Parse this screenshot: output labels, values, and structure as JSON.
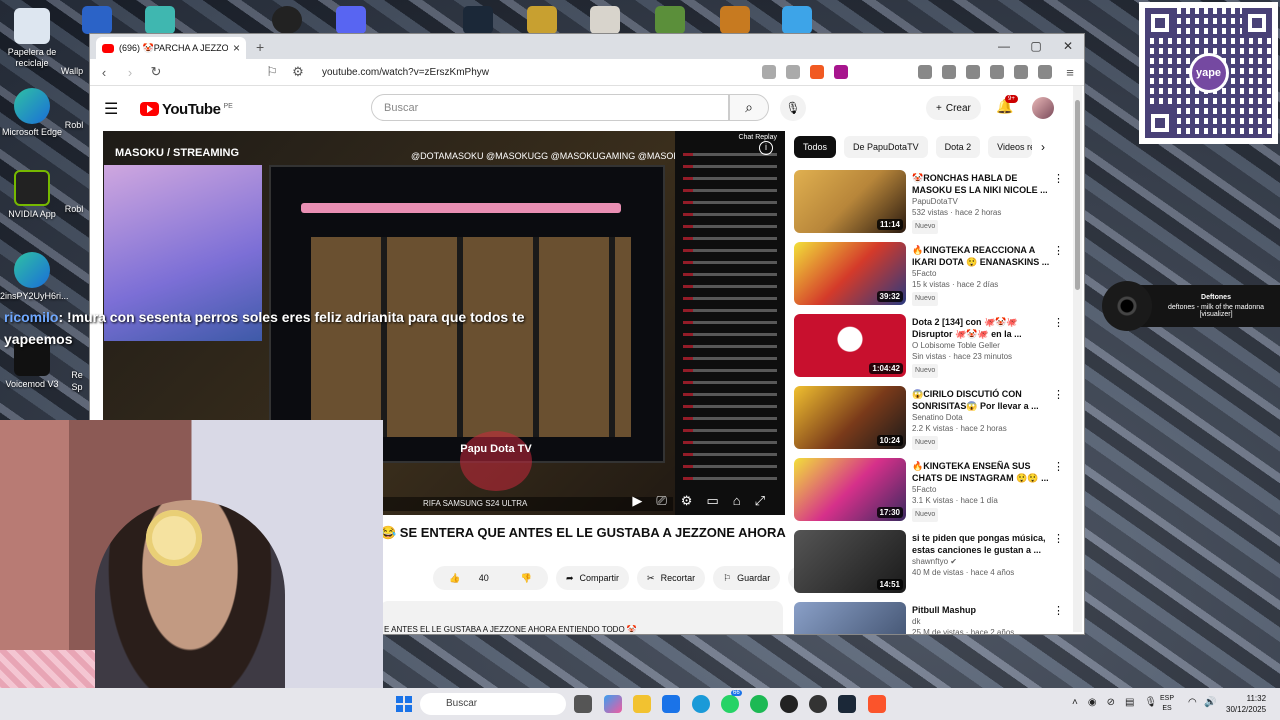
{
  "desktop": {
    "icons": [
      {
        "label": "Papelera de reciclaje"
      },
      {
        "label": "Microsoft Edge"
      },
      {
        "label": "NVIDIA App"
      },
      {
        "label": "2insPY2UyH6ri..."
      },
      {
        "label": "Voicemod V3"
      }
    ],
    "peek_labels": [
      "Wallp",
      "Robl",
      "Robl",
      "Re",
      "Sp"
    ],
    "widget": {
      "title": "Deftones",
      "subtitle": "deftones - milk of the madonna [visualizer]"
    },
    "qr_brand": "yape"
  },
  "browser": {
    "tab_title": "(696) 🤡PARCHA A JEZZONE",
    "url": "youtube.com/watch?v=zErszKmPhyw",
    "new_tab": "+",
    "win_min": "—",
    "win_max": "▢",
    "win_close": "✕"
  },
  "youtube": {
    "logo_text": "YouTube",
    "country": "PE",
    "search_placeholder": "Buscar",
    "create_label": "Crear",
    "notif_count": "9+",
    "player": {
      "stream_label": "MASOKU / STREAMING",
      "socials": "@DOTAMASOKU  @MASOKUGG  @MASOKUGAMING  @MASOKUGG",
      "chat_title": "Chat Replay",
      "watermark": "Papu Dota TV",
      "ticker": "RIFA SAMSUNG S24 ULTRA"
    },
    "video_title": "😂 SE ENTERA QUE ANTES EL LE GUSTABA A JEZZONE AHORA",
    "likes": "40",
    "share_label": "Compartir",
    "clip_label": "Recortar",
    "save_label": "Guardar",
    "description": "E ANTES EL LE GUSTABA A JEZZONE AHORA ENTIENDO TODO 🤡",
    "chips": [
      "Todos",
      "De PapuDotaTV",
      "Dota 2",
      "Videos rel"
    ],
    "recommendations": [
      {
        "title": "🤡RONCHAS HABLA DE MASOKU ES LA NIKI NICOLE ...",
        "channel": "PapuDotaTV",
        "meta": "532 vistas · hace 2 horas",
        "badge": "Nuevo",
        "duration": "11:14",
        "color": "#b8863a"
      },
      {
        "title": "🔥KINGTEKA REACCIONA A IKARI DOTA 😲 ENANASKINS ...",
        "channel": "5Facto",
        "meta": "15 k vistas · hace 2 días",
        "badge": "Nuevo",
        "duration": "39:32",
        "color": "#d43a2a"
      },
      {
        "title": "Dota 2 [134] con 🐙🤡🐙 Disruptor 🐙🤡🐙 en la ...",
        "channel": "O Lobisome Toble Geller",
        "meta": "Sin vistas · hace 23 minutos",
        "badge": "Nuevo",
        "duration": "1:04:42",
        "color": "#c8102e"
      },
      {
        "title": "😱CIRILO DISCUTIÓ CON SONRISITAS😱 Por llevar a ...",
        "channel": "Senatino Dota",
        "meta": "2.2 K vistas · hace 2 horas",
        "badge": "Nuevo",
        "duration": "10:24",
        "color": "#7a3a1a"
      },
      {
        "title": "🔥KINGTEKA ENSEÑA SUS CHATS DE INSTAGRAM 😲😲 ...",
        "channel": "5Facto",
        "meta": "3.1 K vistas · hace 1 día",
        "badge": "Nuevo",
        "duration": "17:30",
        "color": "#d6308a"
      },
      {
        "title": "si te piden que pongas música, estas canciones le gustan a ...",
        "channel": "shawnftyo",
        "meta": "40 M de vistas · hace 4 años",
        "badge": "",
        "duration": "14:51",
        "color": "#2a2a2a"
      },
      {
        "title": "Pitbull Mashup",
        "channel": "dk",
        "meta": "25 M de vistas · hace 2 años",
        "badge": "",
        "duration": "",
        "color": "#3a4a66"
      }
    ]
  },
  "overlay": {
    "chat_name": "ricomilo",
    "chat_text": ": !mura con sesenta perros soles eres feliz adrianita para que todos te",
    "chat_text2": "yapeemos"
  },
  "taskbar": {
    "search_label": "Buscar",
    "whatsapp_badge": "66",
    "lang": "ESP",
    "region": "ES",
    "time": "11:32",
    "date": "30/12/2025"
  }
}
